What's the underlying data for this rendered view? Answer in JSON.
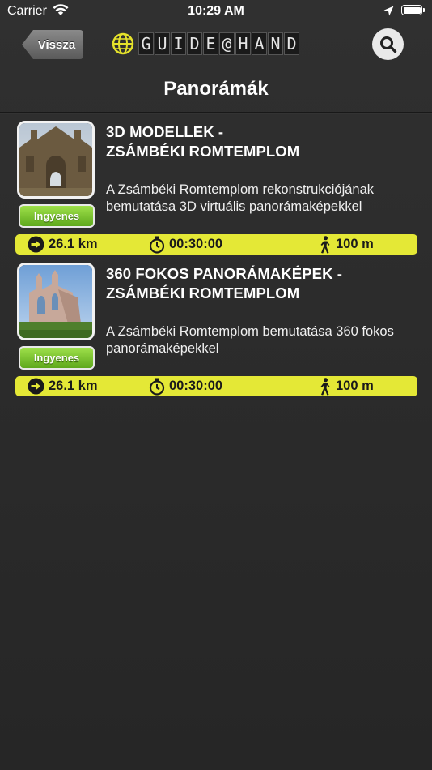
{
  "status_bar": {
    "carrier": "Carrier",
    "time": "10:29 AM",
    "icons": [
      "wifi-icon",
      "location-arrow-icon",
      "battery-icon"
    ]
  },
  "header": {
    "back_label": "Vissza",
    "logo_text": [
      "G",
      "U",
      "I",
      "D",
      "E",
      "@",
      "H",
      "A",
      "N",
      "D"
    ],
    "search_icon": "search-icon",
    "title": "Panorámák"
  },
  "items": [
    {
      "title_line1": "3D MODELLEK -",
      "title_line2": "ZSÁMBÉKI ROMTEMPLOM",
      "description": "A Zsámbéki Romtemplom rekonstrukciójának bemutatása 3D virtuális panorámaképekkel",
      "badge": "Ingyenes",
      "distance": "26.1 km",
      "duration": "00:30:00",
      "walk": "100 m"
    },
    {
      "title_line1": "360 FOKOS PANORÁMAKÉPEK -",
      "title_line2": "ZSÁMBÉKI ROMTEMPLOM",
      "description": "A Zsámbéki Romtemplom bemutatása 360 fokos panorámaképekkel",
      "badge": "Ingyenes",
      "distance": "26.1 km",
      "duration": "00:30:00",
      "walk": "100 m"
    }
  ],
  "colors": {
    "info_bar": "#e4e836",
    "badge": "#7cc431",
    "background": "#2b2b2b"
  }
}
